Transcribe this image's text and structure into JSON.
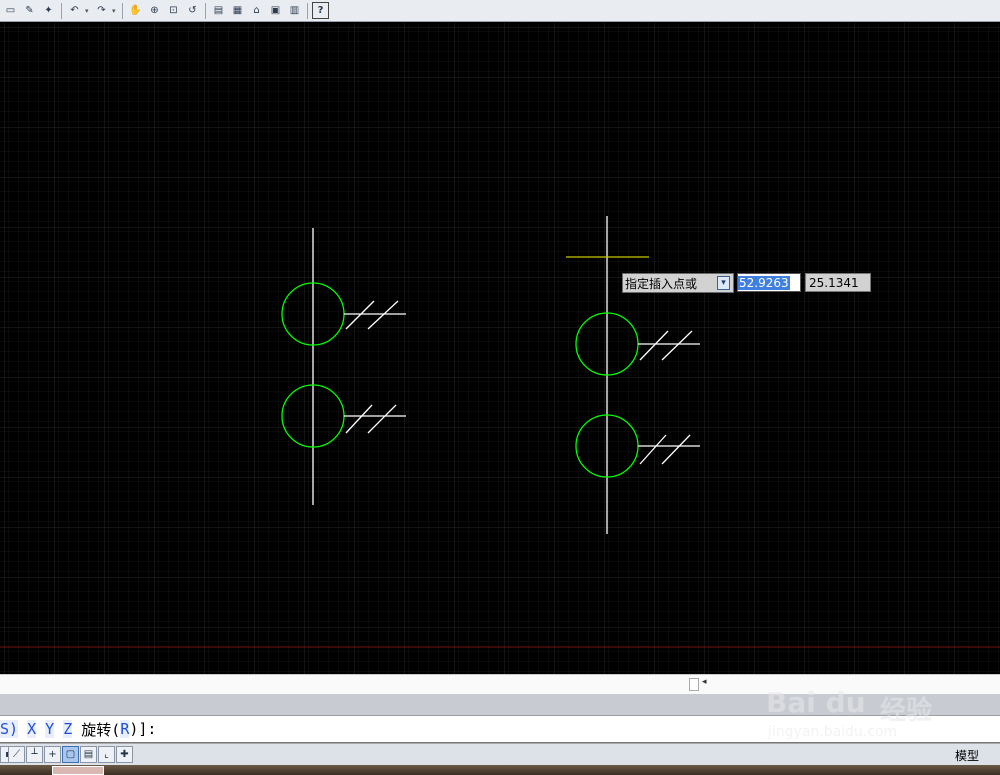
{
  "toolbar": {
    "buttons": [
      "open-icon",
      "publish-icon",
      "undo-icon",
      "redo-icon",
      "pan-icon",
      "zoom-realtime-icon",
      "zoom-window-icon",
      "zoom-previous-icon",
      "properties-icon",
      "design-center-icon",
      "tool-palettes-icon",
      "sheet-set-icon",
      "markup-icon",
      "calculator-icon",
      "help-icon"
    ],
    "help_label": "?"
  },
  "dynamic_input": {
    "prompt": "指定插入点或",
    "arrow": "▾",
    "x_value": "52.9263",
    "y_value": "25.1341"
  },
  "command_line": {
    "segments": [
      {
        "text": "S)",
        "kw": true
      },
      {
        "text": " ",
        "kw": false
      },
      {
        "text": "X",
        "kw": true
      },
      {
        "text": " ",
        "kw": false
      },
      {
        "text": "Y",
        "kw": true
      },
      {
        "text": " ",
        "kw": false
      },
      {
        "text": "Z",
        "kw": true
      },
      {
        "text": " 旋转(",
        "kw": false
      },
      {
        "text": "R",
        "kw": true
      },
      {
        "text": ")]:",
        "kw": false
      }
    ]
  },
  "statusbar": {
    "model_label": "模型",
    "buttons": [
      "snap-icon",
      "ortho-icon",
      "polar-icon",
      "osnap-icon",
      "otrack-icon",
      "ducs-icon",
      "dyn-icon"
    ]
  },
  "watermark": {
    "brand": "Bai du",
    "cn": "经验",
    "url": "jingyan.baidu.com"
  },
  "colors": {
    "background": "#000000",
    "grid": "#1c1c1c",
    "circle": "#00ff00",
    "line": "#ffffff",
    "crosshair": "#c8c800",
    "axis": "#7a1010"
  }
}
